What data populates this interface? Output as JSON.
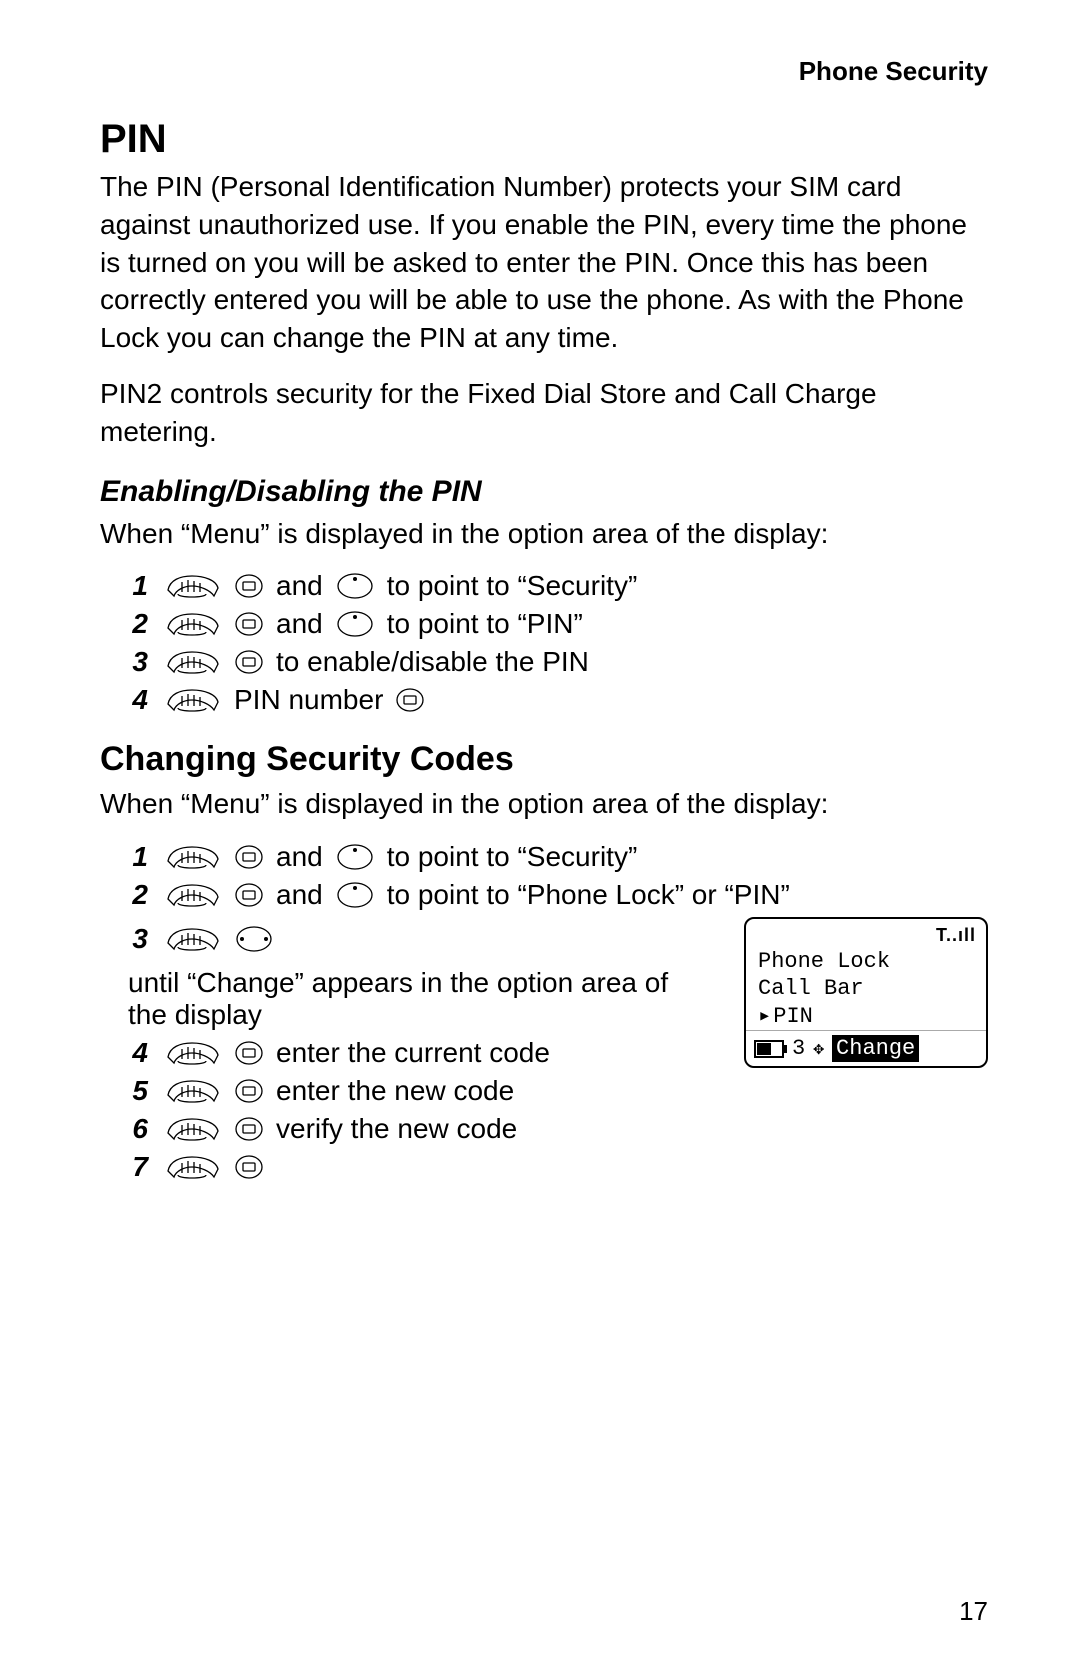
{
  "header": {
    "title": "Phone Security"
  },
  "pin": {
    "heading": "PIN",
    "p1": "The PIN (Personal Identification Number) protects your SIM card against unauthorized use. If you enable the PIN, every time the phone is turned on you will be asked to enter the PIN. Once this has been correctly entered you will be able to use the phone. As with the Phone Lock you can change the PIN at any time.",
    "p2": "PIN2 controls security for the Fixed Dial Store and Call Charge metering."
  },
  "enable": {
    "heading": "Enabling/Disabling the PIN",
    "intro": "When “Menu” is displayed in the option area of the display:",
    "steps": [
      {
        "num": "1",
        "text_a": " and ",
        "text_b": " to point to “Security”",
        "icons": [
          "hand",
          "soft",
          "nav-dot"
        ]
      },
      {
        "num": "2",
        "text_a": " and ",
        "text_b": " to point to “PIN”",
        "icons": [
          "hand",
          "soft",
          "nav-dot"
        ]
      },
      {
        "num": "3",
        "text_a": " to enable/disable the PIN",
        "icons": [
          "hand",
          "soft"
        ]
      },
      {
        "num": "4",
        "text_a": " PIN number ",
        "icons": [
          "hand",
          "",
          "soft-after"
        ]
      }
    ]
  },
  "change": {
    "heading": "Changing Security Codes",
    "intro": "When “Menu” is displayed in the option area of the display:",
    "steps": [
      {
        "num": "1",
        "text_a": " and ",
        "text_b": " to point to “Security”"
      },
      {
        "num": "2",
        "text_a": " and ",
        "text_b": " to point to “Phone Lock” or “PIN”"
      },
      {
        "num": "3",
        "text_a": " until “Change” appears in the option area of the display"
      },
      {
        "num": "4",
        "text_a": " enter the current code"
      },
      {
        "num": "5",
        "text_a": " enter the new code"
      },
      {
        "num": "6",
        "text_a": " verify the new code"
      },
      {
        "num": "7",
        "text_a": ""
      }
    ]
  },
  "phone": {
    "signal": "T..ıll",
    "rows": [
      "Phone Lock",
      "Call Bar",
      "PIN"
    ],
    "selected_index": 2,
    "bottom_num": "3",
    "bottom_label": "Change"
  },
  "page_number": "17"
}
